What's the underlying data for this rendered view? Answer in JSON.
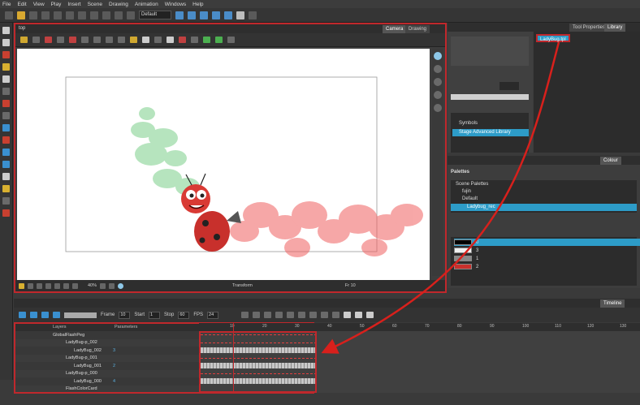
{
  "menu": [
    "File",
    "Edit",
    "View",
    "Play",
    "Insert",
    "Scene",
    "Drawing",
    "Animation",
    "Windows",
    "Help"
  ],
  "toolbar": {
    "workspace": "Default"
  },
  "camera": {
    "tabs": [
      "Camera",
      "Drawing"
    ],
    "breadcrumb": "top",
    "zoom": "40%",
    "status_mode": "Transform",
    "frame_label": "Fr 10"
  },
  "right_top": {
    "tabs": [
      "Tool Properties",
      "Library"
    ],
    "library_selected": "LadyBug.tpl",
    "tree": [
      "Symbols",
      "Stage Advanced Library"
    ]
  },
  "colour": {
    "tab": "Colour",
    "section": "Palettes",
    "scene_palettes_label": "Scene Palettes",
    "palettes": [
      "fujin",
      "Default",
      "Ladybug_rec"
    ],
    "swatches": [
      {
        "label": "0",
        "color": "#000000"
      },
      {
        "label": "3",
        "color": "#f0f0f0"
      },
      {
        "label": "1",
        "color": "#888888"
      },
      {
        "label": "2",
        "color": "#c8302c"
      }
    ]
  },
  "timeline": {
    "tab": "Timeline",
    "frame_label": "Frame",
    "frame_value": "10",
    "start_label": "Start",
    "start_value": "1",
    "stop_label": "Stop",
    "stop_value": "60",
    "fps_label": "FPS",
    "fps_value": "24",
    "layers_header": "Layers",
    "params_header": "Parameters",
    "layers": [
      {
        "name": "GlobalFlashPeg",
        "indent": 0,
        "num": ""
      },
      {
        "name": "LadyBug-p_002",
        "indent": 1,
        "num": ""
      },
      {
        "name": "LadyBug_002",
        "indent": 2,
        "num": "3"
      },
      {
        "name": "LadyBug-p_001",
        "indent": 1,
        "num": ""
      },
      {
        "name": "LadyBug_001",
        "indent": 2,
        "num": "2"
      },
      {
        "name": "LadyBug-p_000",
        "indent": 1,
        "num": ""
      },
      {
        "name": "LadyBug_000",
        "indent": 2,
        "num": "4"
      },
      {
        "name": "FlashColorCard",
        "indent": 1,
        "num": ""
      }
    ],
    "ruler": [
      "10",
      "20",
      "30",
      "40",
      "50",
      "60",
      "70",
      "80",
      "90",
      "100",
      "110",
      "120",
      "130"
    ]
  }
}
